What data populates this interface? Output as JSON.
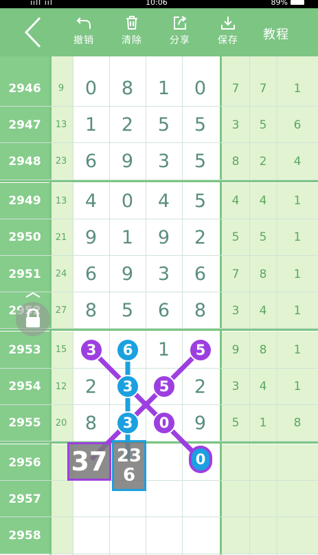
{
  "status": {
    "signal": "ııll ııl",
    "time": "10:06",
    "battery": "89%"
  },
  "header": {
    "back_label": "back",
    "tools": [
      {
        "id": "undo",
        "label": "撤销",
        "icon": "undo-icon"
      },
      {
        "id": "clear",
        "label": "清除",
        "icon": "trash-icon"
      },
      {
        "id": "share",
        "label": "分享",
        "icon": "share-icon"
      },
      {
        "id": "save",
        "label": "保存",
        "icon": "download-icon"
      }
    ],
    "tutorial_label": "教程"
  },
  "rows": [
    {
      "issue": "2946",
      "sum": "9",
      "digits": [
        "0",
        "8",
        "1",
        "0"
      ],
      "right": [
        "7",
        "7",
        "1"
      ]
    },
    {
      "issue": "2947",
      "sum": "13",
      "digits": [
        "1",
        "2",
        "5",
        "5"
      ],
      "right": [
        "3",
        "5",
        "6"
      ]
    },
    {
      "issue": "2948",
      "sum": "23",
      "digits": [
        "6",
        "9",
        "3",
        "5"
      ],
      "right": [
        "8",
        "2",
        "4"
      ]
    },
    {
      "issue": "2949",
      "sum": "13",
      "digits": [
        "4",
        "0",
        "4",
        "5"
      ],
      "right": [
        "4",
        "4",
        "1"
      ]
    },
    {
      "issue": "2950",
      "sum": "21",
      "digits": [
        "9",
        "1",
        "9",
        "2"
      ],
      "right": [
        "5",
        "5",
        "1"
      ]
    },
    {
      "issue": "2951",
      "sum": "24",
      "digits": [
        "6",
        "9",
        "3",
        "6"
      ],
      "right": [
        "7",
        "8",
        "1"
      ]
    },
    {
      "issue": "2952",
      "sum": "27",
      "digits": [
        "8",
        "5",
        "6",
        "8"
      ],
      "right": [
        "3",
        "4",
        "1"
      ]
    },
    {
      "issue": "2953",
      "sum": "15",
      "digits": [
        "3",
        "6",
        "1",
        "5"
      ],
      "right": [
        "9",
        "8",
        "1"
      ]
    },
    {
      "issue": "2954",
      "sum": "12",
      "digits": [
        "2",
        "3",
        "5",
        "2"
      ],
      "right": [
        "3",
        "4",
        "1"
      ]
    },
    {
      "issue": "2955",
      "sum": "20",
      "digits": [
        "8",
        "3",
        "0",
        "9"
      ],
      "right": [
        "5",
        "1",
        "8"
      ]
    },
    {
      "issue": "2956",
      "sum": "",
      "digits": [
        "",
        "",
        "",
        ""
      ],
      "right": [
        "",
        "",
        ""
      ]
    },
    {
      "issue": "2957",
      "sum": "",
      "digits": [
        "",
        "",
        "",
        ""
      ],
      "right": [
        "",
        "",
        ""
      ]
    },
    {
      "issue": "2958",
      "sum": "",
      "digits": [
        "",
        "",
        "",
        ""
      ],
      "right": [
        "",
        "",
        ""
      ]
    }
  ],
  "overlay": {
    "marks": [
      {
        "text": "3",
        "color": "purple",
        "row": 7,
        "col": 0
      },
      {
        "text": "6",
        "color": "blue",
        "row": 7,
        "col": 1
      },
      {
        "text": "5",
        "color": "purple",
        "row": 7,
        "col": 3
      },
      {
        "text": "3",
        "color": "blue",
        "row": 8,
        "col": 1
      },
      {
        "text": "5",
        "color": "purple",
        "row": 8,
        "col": 2
      },
      {
        "text": "3",
        "color": "blue",
        "row": 9,
        "col": 1
      },
      {
        "text": "0",
        "color": "purple",
        "row": 9,
        "col": 2
      }
    ],
    "summary_purple": "37",
    "summary_blue_top": "23",
    "summary_blue_bottom": "6",
    "end_marker": "0",
    "colors": {
      "purple": "#9d3fe0",
      "blue": "#1ba0e0",
      "green": "#7cc583"
    }
  }
}
